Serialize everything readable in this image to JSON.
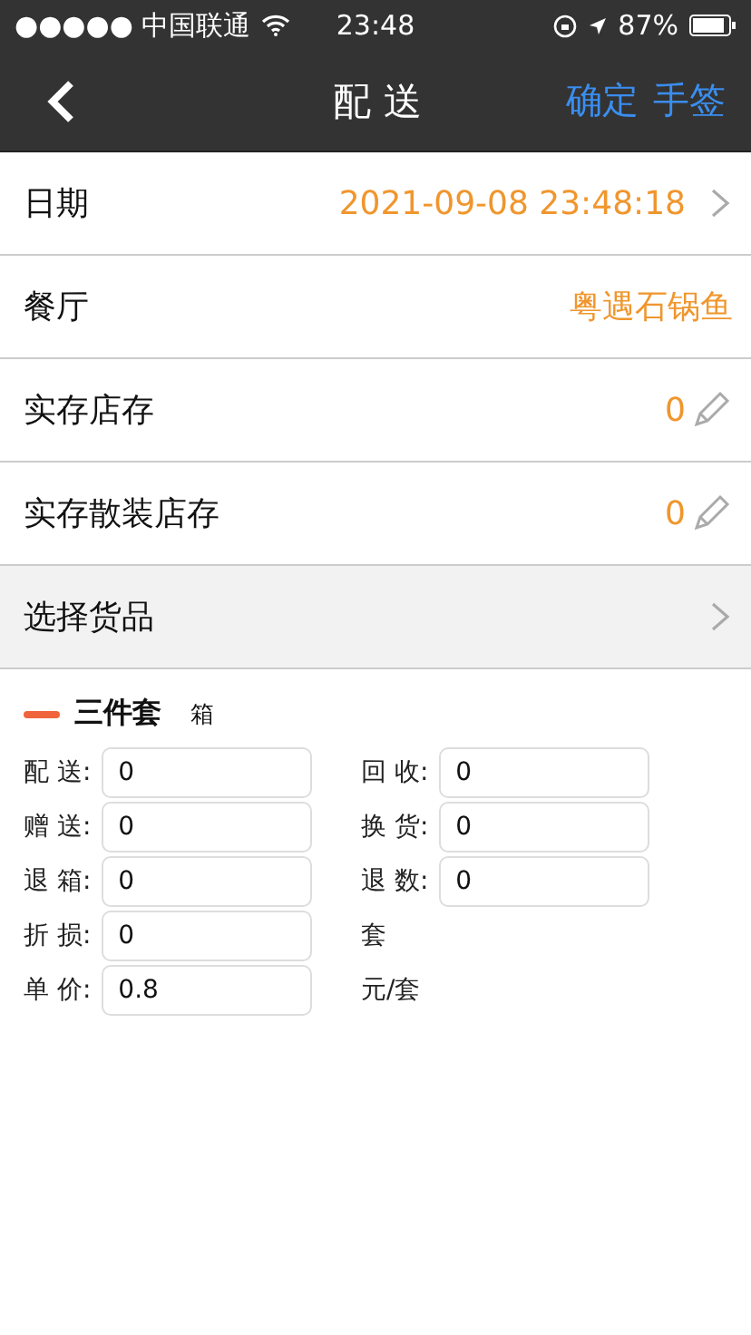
{
  "status_bar": {
    "carrier": "●●●●● 中国联通",
    "time": "23:48",
    "battery": "87%"
  },
  "nav": {
    "title": "配 送",
    "actions": [
      "确定",
      "手签"
    ]
  },
  "rows": [
    {
      "kind": "picker",
      "label": "日期",
      "value": "2021-09-08 23:48:18"
    },
    {
      "kind": "value",
      "label": "餐厅",
      "value": "粤遇石锅鱼"
    },
    {
      "kind": "edit",
      "label": "实存店存",
      "value": "0"
    },
    {
      "kind": "edit",
      "label": "实存散装店存",
      "value": "0"
    },
    {
      "kind": "link",
      "label": "选择货品"
    }
  ],
  "product": {
    "name": "三件套",
    "unit": "箱",
    "color": "#f0643c",
    "cells": [
      {
        "kind": "field",
        "label": "配 送:",
        "value": "0"
      },
      {
        "kind": "field",
        "label": "回 收:",
        "value": "0"
      },
      {
        "kind": "field",
        "label": "赠 送:",
        "value": "0"
      },
      {
        "kind": "field",
        "label": "换 货:",
        "value": "0"
      },
      {
        "kind": "field",
        "label": "退 箱:",
        "value": "0"
      },
      {
        "kind": "field",
        "label": "退 数:",
        "value": "0"
      },
      {
        "kind": "field",
        "label": "折 损:",
        "value": "0"
      },
      {
        "kind": "unit",
        "text": "套"
      },
      {
        "kind": "field",
        "label": "单 价:",
        "value": "0.8"
      },
      {
        "kind": "unit",
        "text": "元/套"
      }
    ]
  }
}
